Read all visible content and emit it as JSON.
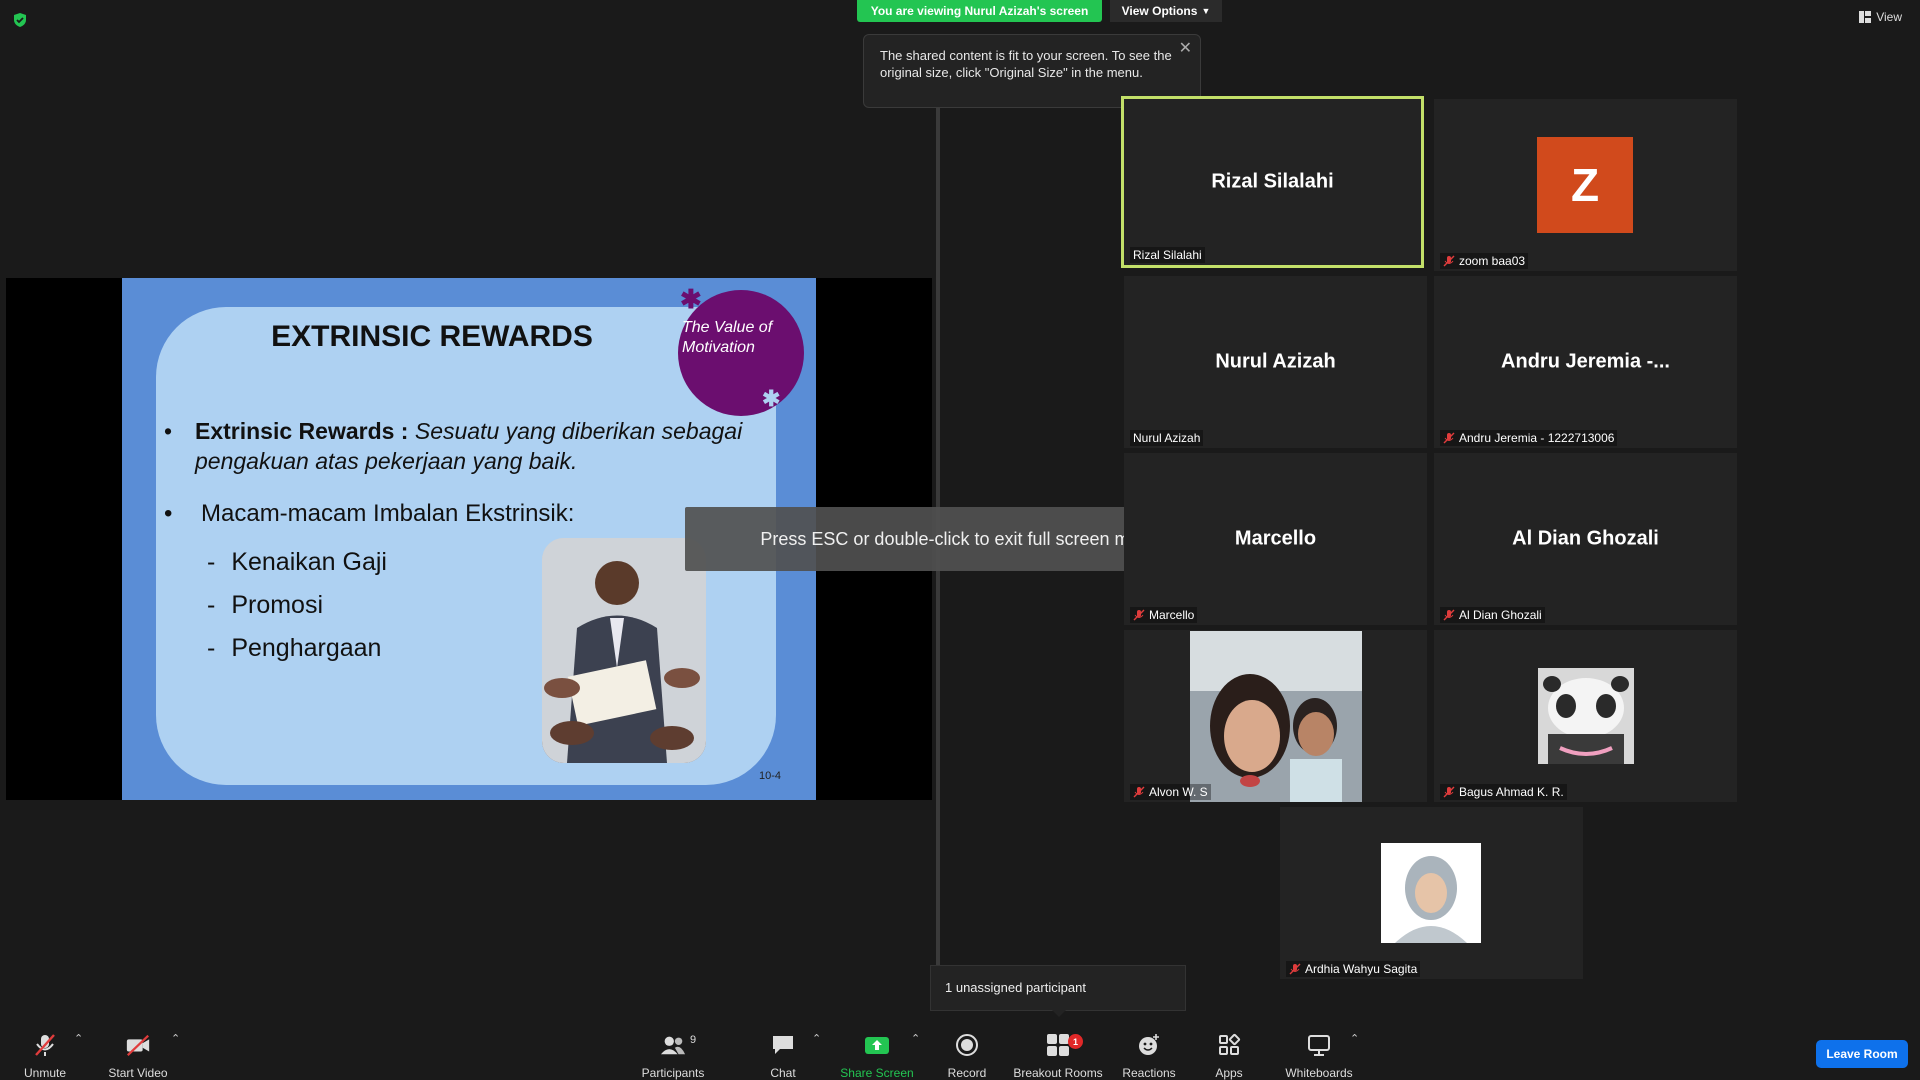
{
  "top": {
    "viewing_banner": "You are viewing Nurul Azizah's screen",
    "view_options": "View Options",
    "view_label": "View"
  },
  "tooltip": {
    "text": "The shared content is fit to your screen. To see the original size, click \"Original Size\" in the menu."
  },
  "slide": {
    "title": "EXTRINSIC REWARDS",
    "circle_text": "The Value of Motivation",
    "bullet1_label": "Extrinsic Rewards :",
    "bullet1_desc": "Sesuatu yang diberikan sebagai pengakuan atas pekerjaan yang baik.",
    "bullet2": "Macam-macam Imbalan Ekstrinsik:",
    "sub_items": [
      "Kenaikan Gaji",
      "Promosi",
      "Penghargaan"
    ],
    "slide_number": "10-4"
  },
  "overlay": {
    "esc_message": "Press ESC or double-click to exit full screen mode"
  },
  "participants_grid": [
    {
      "display": "Rizal Silalahi",
      "label": "Rizal Silalahi",
      "muted": false,
      "active": true
    },
    {
      "display": "Z",
      "label": "zoom baa03",
      "muted": true
    },
    {
      "display": "Nurul Azizah",
      "label": "Nurul Azizah",
      "muted": false
    },
    {
      "display": "Andru Jeremia -...",
      "label": "Andru Jeremia - 1222713006",
      "muted": true
    },
    {
      "display": "Marcello",
      "label": "Marcello",
      "muted": true
    },
    {
      "display": "Al Dian Ghozali",
      "label": "Al Dian Ghozali",
      "muted": true
    },
    {
      "display": "",
      "label": "Alvon W. S",
      "muted": true
    },
    {
      "display": "",
      "label": "Bagus Ahmad K. R.",
      "muted": true
    },
    {
      "display": "",
      "label": "Ardhia Wahyu Sagita",
      "muted": true
    }
  ],
  "unassigned": "1 unassigned participant",
  "toolbar": {
    "unmute": "Unmute",
    "start_video": "Start Video",
    "participants": "Participants",
    "participants_count": "9",
    "chat": "Chat",
    "share_screen": "Share Screen",
    "record": "Record",
    "breakout_rooms": "Breakout Rooms",
    "breakout_badge": "1",
    "reactions": "Reactions",
    "apps": "Apps",
    "whiteboards": "Whiteboards",
    "leave_room": "Leave Room"
  },
  "colors": {
    "accent_green": "#23c552",
    "active_speaker": "#c3e069",
    "leave_blue": "#0e71eb",
    "zoom_avatar": "#d14a1c",
    "slide_purple": "#6b0e6f"
  }
}
